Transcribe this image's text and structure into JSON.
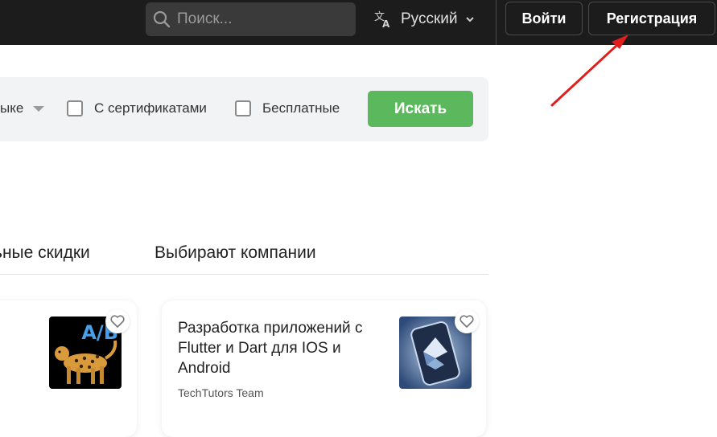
{
  "header": {
    "search_placeholder": "Поиск...",
    "language": "Русский",
    "login_label": "Войти",
    "register_label": "Регистрация"
  },
  "filters": {
    "select_tail": "ыке",
    "certificates_label": "С сертификатами",
    "free_label": "Бесплатные",
    "search_button": "Искать"
  },
  "tabs": [
    "ьные скидки",
    "Выбирают компании"
  ],
  "cards": [
    {
      "thumb_text": "A/B"
    },
    {
      "title": "Разработка приложений с Flutter и Dart для IOS и Android",
      "author": "TechTutors Team"
    }
  ],
  "colors": {
    "header_bg": "#1c1c1c",
    "accent_green": "#5cb85c",
    "arrow": "#e11d1d"
  }
}
